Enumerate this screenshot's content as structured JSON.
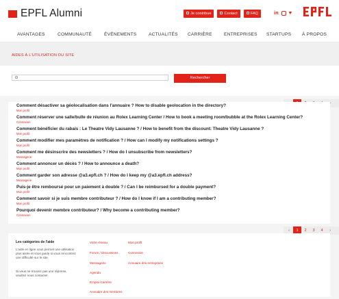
{
  "header": {
    "brand": "EPFL Alumni",
    "actions": [
      "Je contribue",
      "Contact",
      "FAQ"
    ],
    "social_icons": [
      "linkedin-icon",
      "instagram-icon",
      "twitter-icon"
    ],
    "logo_text": "EPFL",
    "linkedin_label": "in",
    "twitter_label": "♥"
  },
  "nav": [
    "AVANTAGES",
    "COMMUNAUTÉ",
    "ÉVÉNEMENTS",
    "ACTUALITÉS",
    "CARRIÈRE",
    "ENTREPRISES",
    "STARTUPS",
    "À PROPOS"
  ],
  "page_title": "AIDES À L'UTILISATION DU SITE",
  "search": {
    "placeholder": "",
    "button": "Rechercher"
  },
  "pagination": [
    "‹",
    "1",
    "2",
    "3",
    "4",
    "›"
  ],
  "pagination_current": "1",
  "questions": [
    {
      "title": "Comment désactiver sa géolocalisation dans l'annuaire ? How to disable geolocation in the directory?",
      "category": "Mon profil"
    },
    {
      "title": "Comment réserver une salle/bulle de réunion au Rolex Learning Center / How to book a meeting room/bubble at the Rolex Learning Center?",
      "category": "Connexion"
    },
    {
      "title": "Comment bénéficier du rabais : Le Theatre Vidy Lausanne ? / How to benefit from the discount: Theatre Vidy Lausanne ?",
      "category": "Mon profil"
    },
    {
      "title": "Comment modifier mes paramètres de notification ? / How can I modify my notifications settings ?",
      "category": "Mon profil"
    },
    {
      "title": "Comment me désinscrire des newsletters ? / How do I unsubscribe from newsletters?",
      "category": "Messagerie"
    },
    {
      "title": "Comment annoncer un décès ? / How to announce a death?",
      "category": "Mon profil"
    },
    {
      "title": "Comment garder son adresse @a3.epfl.ch ? / How do I keep my @a3.epfl.ch address?",
      "category": "Messagerie"
    },
    {
      "title": "Puis-je être remboursé pour un paiement à double ? / Can I be reimbursed for a double payment?",
      "category": "Mon profil"
    },
    {
      "title": "Comment savoir si je suis membre contributeur ? / How do I know if I am a contributing member?",
      "category": "Mon profil"
    },
    {
      "title": "Pourquoi devenir membre contributeur? / Why become a contributing member?",
      "category": "Connexion"
    }
  ],
  "footer": {
    "title": "Les catégories de l'aide",
    "text1": "L'aide en ligne vous permet une utilisation plus aisée et vous guide si vous rencontrez une difficulté sur le site.",
    "text2": "Si vous ne trouvez pas une réponse, veuillez nous contacter.",
    "col1": [
      "Votre réseau",
      "Forum / Discussions",
      "Messagerie",
      "Agenda",
      "Emploi Carrière",
      "Annuaire des membres"
    ],
    "col2": [
      "Mon profil",
      "Connexion",
      "Annuaire des entreprises"
    ]
  },
  "colors": {
    "accent": "#e2231a",
    "banner": "#f0f0f0",
    "page_bg": "#f4f4f4"
  }
}
